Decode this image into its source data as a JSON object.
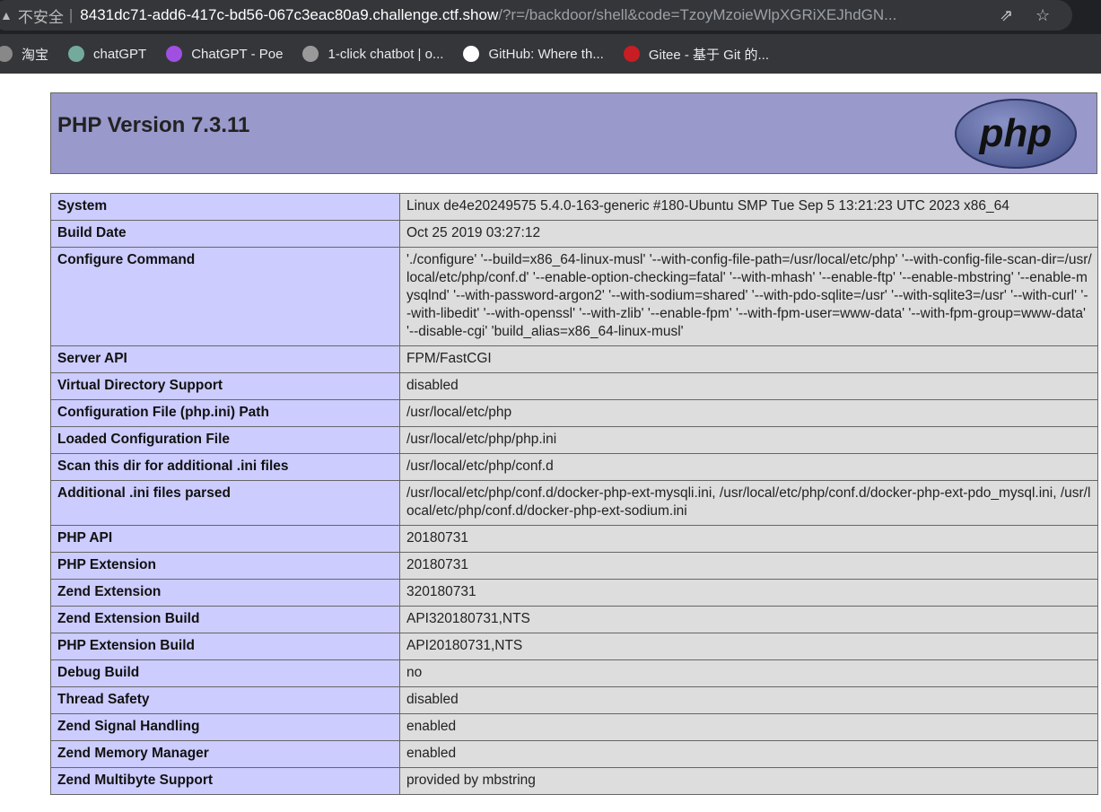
{
  "browser": {
    "security_label": "不安全",
    "url_host": "8431dc71-add6-417c-bd56-067c3eac80a9.challenge.ctf.show",
    "url_path": "/?r=/backdoor/shell&code=TzoyMzoieWlpXGRiXEJhdGN...",
    "bookmarks": [
      {
        "label": "淘宝",
        "icon": "taobao-icon",
        "color": "#888"
      },
      {
        "label": "chatGPT",
        "icon": "openai-icon",
        "color": "#74aa9c"
      },
      {
        "label": "ChatGPT - Poe",
        "icon": "poe-icon",
        "color": "#a050e0"
      },
      {
        "label": "1-click chatbot | o...",
        "icon": "checker-icon",
        "color": "#999"
      },
      {
        "label": "GitHub: Where th...",
        "icon": "github-icon",
        "color": "#fff"
      },
      {
        "label": "Gitee - 基于 Git 的...",
        "icon": "gitee-icon",
        "color": "#c71d23"
      }
    ]
  },
  "header": {
    "title": "PHP Version 7.3.11",
    "logo_text": "php"
  },
  "rows": [
    {
      "k": "System",
      "v": "Linux de4e20249575 5.4.0-163-generic #180-Ubuntu SMP Tue Sep 5 13:21:23 UTC 2023 x86_64"
    },
    {
      "k": "Build Date",
      "v": "Oct 25 2019 03:27:12"
    },
    {
      "k": "Configure Command",
      "v": "'./configure' '--build=x86_64-linux-musl' '--with-config-file-path=/usr/local/etc/php' '--with-config-file-scan-dir=/usr/local/etc/php/conf.d' '--enable-option-checking=fatal' '--with-mhash' '--enable-ftp' '--enable-mbstring' '--enable-mysqlnd' '--with-password-argon2' '--with-sodium=shared' '--with-pdo-sqlite=/usr' '--with-sqlite3=/usr' '--with-curl' '--with-libedit' '--with-openssl' '--with-zlib' '--enable-fpm' '--with-fpm-user=www-data' '--with-fpm-group=www-data' '--disable-cgi' 'build_alias=x86_64-linux-musl'"
    },
    {
      "k": "Server API",
      "v": "FPM/FastCGI"
    },
    {
      "k": "Virtual Directory Support",
      "v": "disabled"
    },
    {
      "k": "Configuration File (php.ini) Path",
      "v": "/usr/local/etc/php"
    },
    {
      "k": "Loaded Configuration File",
      "v": "/usr/local/etc/php/php.ini"
    },
    {
      "k": "Scan this dir for additional .ini files",
      "v": "/usr/local/etc/php/conf.d"
    },
    {
      "k": "Additional .ini files parsed",
      "v": "/usr/local/etc/php/conf.d/docker-php-ext-mysqli.ini, /usr/local/etc/php/conf.d/docker-php-ext-pdo_mysql.ini, /usr/local/etc/php/conf.d/docker-php-ext-sodium.ini"
    },
    {
      "k": "PHP API",
      "v": "20180731"
    },
    {
      "k": "PHP Extension",
      "v": "20180731"
    },
    {
      "k": "Zend Extension",
      "v": "320180731"
    },
    {
      "k": "Zend Extension Build",
      "v": "API320180731,NTS"
    },
    {
      "k": "PHP Extension Build",
      "v": "API20180731,NTS"
    },
    {
      "k": "Debug Build",
      "v": "no"
    },
    {
      "k": "Thread Safety",
      "v": "disabled"
    },
    {
      "k": "Zend Signal Handling",
      "v": "enabled"
    },
    {
      "k": "Zend Memory Manager",
      "v": "enabled"
    },
    {
      "k": "Zend Multibyte Support",
      "v": "provided by mbstring"
    }
  ]
}
